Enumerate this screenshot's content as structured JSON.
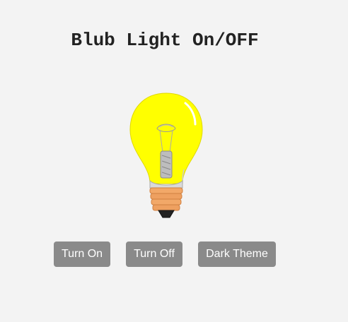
{
  "page": {
    "title": "Blub Light On/OFF",
    "background_color": "#f3f3f3"
  },
  "bulb": {
    "state": "on",
    "icon": "lightbulb-icon",
    "glass_color": "#ffff00",
    "base_color": "#f0a060"
  },
  "controls": {
    "turn_on_label": "Turn On",
    "turn_off_label": "Turn Off",
    "dark_theme_label": "Dark Theme",
    "button_color": "#8a8a8a"
  }
}
